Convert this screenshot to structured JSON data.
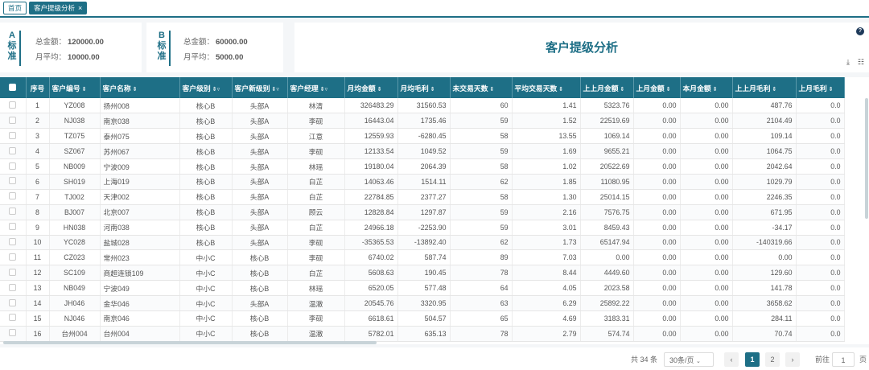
{
  "tabs": [
    {
      "label": "首页"
    },
    {
      "label": "客户提级分析",
      "close": "×"
    }
  ],
  "cards": {
    "a": {
      "letter": [
        "A",
        "标",
        "准"
      ],
      "total_label": "总金额：",
      "total": "120000.00",
      "avg_label": "月平均：",
      "avg": "10000.00"
    },
    "b": {
      "letter": [
        "B",
        "标",
        "准"
      ],
      "total_label": "总金额：",
      "total": "60000.00",
      "avg_label": "月平均：",
      "avg": "5000.00"
    }
  },
  "title": "客户提级分析",
  "icons": {
    "help": "?",
    "download": "⤓",
    "columns": "☷"
  },
  "table": {
    "columns": [
      "序号",
      "客户编号",
      "客户名称",
      "客户级别",
      "客户新级别",
      "客户经理",
      "月均金额",
      "月均毛利",
      "未交易天数",
      "平均交易天数",
      "上上月金额",
      "上月金额",
      "本月金额",
      "上上月毛利",
      "上月毛利"
    ],
    "rows": [
      [
        "1",
        "YZ008",
        "扬州008",
        "核心B",
        "头部A",
        "林清",
        "326483.29",
        "31560.53",
        "60",
        "1.41",
        "5323.76",
        "0.00",
        "0.00",
        "487.76",
        "0.0"
      ],
      [
        "2",
        "NJ038",
        "南京038",
        "核心B",
        "头部A",
        "李砚",
        "16443.04",
        "1735.46",
        "59",
        "1.52",
        "22519.69",
        "0.00",
        "0.00",
        "2104.49",
        "0.0"
      ],
      [
        "3",
        "TZ075",
        "泰州075",
        "核心B",
        "头部A",
        "江意",
        "12559.93",
        "-6280.45",
        "58",
        "13.55",
        "1069.14",
        "0.00",
        "0.00",
        "109.14",
        "0.0"
      ],
      [
        "4",
        "SZ067",
        "苏州067",
        "核心B",
        "头部A",
        "李砚",
        "12133.54",
        "1049.52",
        "59",
        "1.69",
        "9655.21",
        "0.00",
        "0.00",
        "1064.75",
        "0.0"
      ],
      [
        "5",
        "NB009",
        "宁波009",
        "核心B",
        "头部A",
        "林瑶",
        "19180.04",
        "2064.39",
        "58",
        "1.02",
        "20522.69",
        "0.00",
        "0.00",
        "2042.64",
        "0.0"
      ],
      [
        "6",
        "SH019",
        "上海019",
        "核心B",
        "头部A",
        "白芷",
        "14063.46",
        "1514.11",
        "62",
        "1.85",
        "11080.95",
        "0.00",
        "0.00",
        "1029.79",
        "0.0"
      ],
      [
        "7",
        "TJ002",
        "天津002",
        "核心B",
        "头部A",
        "白芷",
        "22784.85",
        "2377.27",
        "58",
        "1.30",
        "25014.15",
        "0.00",
        "0.00",
        "2246.35",
        "0.0"
      ],
      [
        "8",
        "BJ007",
        "北京007",
        "核心B",
        "头部A",
        "顾云",
        "12828.84",
        "1297.87",
        "59",
        "2.16",
        "7576.75",
        "0.00",
        "0.00",
        "671.95",
        "0.0"
      ],
      [
        "9",
        "HN038",
        "河南038",
        "核心B",
        "头部A",
        "白芷",
        "24966.18",
        "-2253.90",
        "59",
        "3.01",
        "8459.43",
        "0.00",
        "0.00",
        "-34.17",
        "0.0"
      ],
      [
        "10",
        "YC028",
        "盐城028",
        "核心B",
        "头部A",
        "李砚",
        "-35365.53",
        "-13892.40",
        "62",
        "1.73",
        "65147.94",
        "0.00",
        "0.00",
        "-140319.66",
        "0.0"
      ],
      [
        "11",
        "CZ023",
        "常州023",
        "中小C",
        "核心B",
        "李砚",
        "6740.02",
        "587.74",
        "89",
        "7.03",
        "0.00",
        "0.00",
        "0.00",
        "0.00",
        "0.0"
      ],
      [
        "12",
        "SC109",
        "商超连锁109",
        "中小C",
        "核心B",
        "白芷",
        "5608.63",
        "190.45",
        "78",
        "8.44",
        "4449.60",
        "0.00",
        "0.00",
        "129.60",
        "0.0"
      ],
      [
        "13",
        "NB049",
        "宁波049",
        "中小C",
        "核心B",
        "林瑶",
        "6520.05",
        "577.48",
        "64",
        "4.05",
        "2023.58",
        "0.00",
        "0.00",
        "141.78",
        "0.0"
      ],
      [
        "14",
        "JH046",
        "金华046",
        "中小C",
        "头部A",
        "温澈",
        "20545.76",
        "3320.95",
        "63",
        "6.29",
        "25892.22",
        "0.00",
        "0.00",
        "3658.62",
        "0.0"
      ],
      [
        "15",
        "NJ046",
        "南京046",
        "中小C",
        "核心B",
        "李砚",
        "6618.61",
        "504.57",
        "65",
        "4.69",
        "3183.31",
        "0.00",
        "0.00",
        "284.11",
        "0.0"
      ],
      [
        "16",
        "台州004",
        "台州004",
        "中小C",
        "核心B",
        "温澈",
        "5782.01",
        "635.13",
        "78",
        "2.79",
        "574.74",
        "0.00",
        "0.00",
        "70.74",
        "0.0"
      ]
    ]
  },
  "pager": {
    "total": "共 34 条",
    "page_size": "30条/页",
    "prev": "‹",
    "next": "›",
    "pages": [
      "1",
      "2"
    ],
    "goto": "前往",
    "goto_value": "1",
    "page_unit": "页"
  }
}
